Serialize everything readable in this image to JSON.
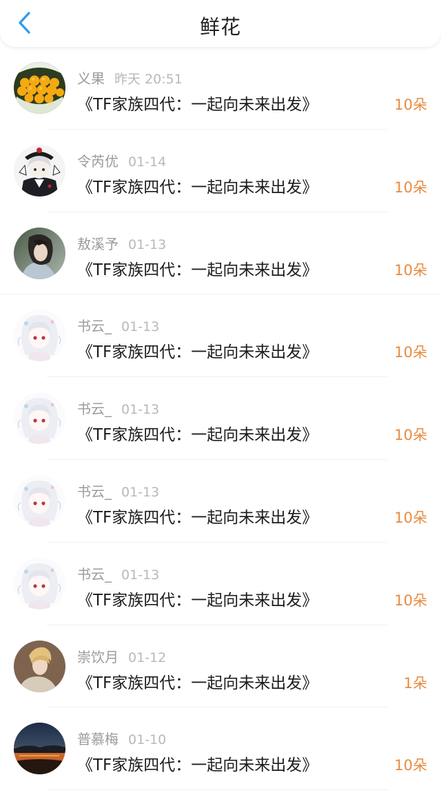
{
  "header": {
    "title": "鲜花",
    "back_icon": "chevron-left-icon"
  },
  "accent": "#2e9cf0",
  "count_color": "#e88a3c",
  "items": [
    {
      "name": "义果",
      "date": "昨天 20:51",
      "work": "《TF家族四代：一起向未来出发》",
      "count": "10朵",
      "avatar": "avatar-mango"
    },
    {
      "name": "令芮优",
      "date": "01-14",
      "work": "《TF家族四代：一起向未来出发》",
      "count": "10朵",
      "avatar": "avatar-anime-dark"
    },
    {
      "name": "敖溪予",
      "date": "01-13",
      "work": "《TF家族四代：一起向未来出发》",
      "count": "10朵",
      "avatar": "avatar-photo"
    },
    {
      "name": "书云_",
      "date": "01-13",
      "work": "《TF家族四代：一起向未来出发》",
      "count": "10朵",
      "avatar": "avatar-anime-light"
    },
    {
      "name": "书云_",
      "date": "01-13",
      "work": "《TF家族四代：一起向未来出发》",
      "count": "10朵",
      "avatar": "avatar-anime-light"
    },
    {
      "name": "书云_",
      "date": "01-13",
      "work": "《TF家族四代：一起向未来出发》",
      "count": "10朵",
      "avatar": "avatar-anime-light"
    },
    {
      "name": "书云_",
      "date": "01-13",
      "work": "《TF家族四代：一起向未来出发》",
      "count": "10朵",
      "avatar": "avatar-anime-light"
    },
    {
      "name": "崇饮月",
      "date": "01-12",
      "work": "《TF家族四代：一起向未来出发》",
      "count": "1朵",
      "avatar": "avatar-portrait"
    },
    {
      "name": "普慕梅",
      "date": "01-10",
      "work": "《TF家族四代：一起向未来出发》",
      "count": "10朵",
      "avatar": "avatar-sunset"
    }
  ]
}
